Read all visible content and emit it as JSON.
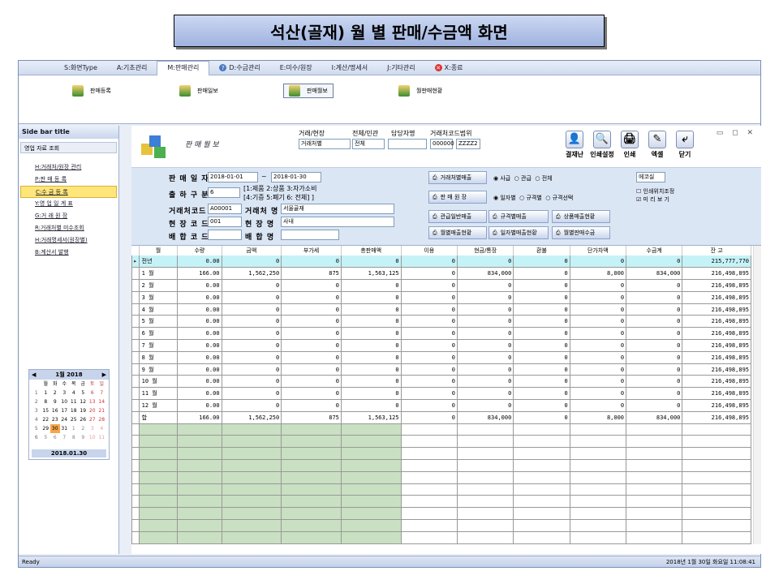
{
  "banner": "석산(골재) 월 별 판매/수금액  화면",
  "menu": [
    {
      "label": "S:화면Type"
    },
    {
      "label": "A:기초관리"
    },
    {
      "label": "M:판매관리",
      "active": true
    },
    {
      "label": "D:수금관리",
      "icon": "?"
    },
    {
      "label": "E:미수/원장"
    },
    {
      "label": "I:계산/명세서"
    },
    {
      "label": "J:기타관리"
    },
    {
      "label": "X:종료",
      "icon": "x"
    }
  ],
  "ribbon": [
    "판매등록",
    "판매일보",
    "판매월보",
    "월판매현황"
  ],
  "sidebar": {
    "title": "Side bar title",
    "group": "영업 자료 조회",
    "items": [
      "H:거래처/원장 관리",
      "P:판 매 등 록",
      "C:수 금 등 록",
      "Y:영 업 일 계 표",
      "G:거 래 원 장",
      "R:거래처별 미수조회",
      "H:거래명세서(원장별)",
      "B:계산서 발행"
    ],
    "selected": 2
  },
  "calendar": {
    "month": "1월 2018",
    "days": [
      "월",
      "화",
      "수",
      "목",
      "금",
      "토",
      "일"
    ],
    "weeks": [
      [
        "1",
        "2",
        "3",
        "4",
        "5",
        "6",
        "7"
      ],
      [
        "8",
        "9",
        "10",
        "11",
        "12",
        "13",
        "14"
      ],
      [
        "15",
        "16",
        "17",
        "18",
        "19",
        "20",
        "21"
      ],
      [
        "22",
        "23",
        "24",
        "25",
        "26",
        "27",
        "28"
      ],
      [
        "29",
        "30",
        "31",
        "1",
        "2",
        "3",
        "4"
      ],
      [
        "5",
        "6",
        "7",
        "8",
        "9",
        "10",
        "11"
      ]
    ],
    "week_nums": [
      "1",
      "2",
      "3",
      "4",
      "5",
      "6"
    ],
    "today": "2018.01.30"
  },
  "main": {
    "title": "판 매 월 보",
    "trade_label": "거래/현장",
    "trade_value": "거래처별",
    "type_label": "전체/민관",
    "type_value": "전체",
    "staff_label": "담당자명",
    "range_label": "거래처코드범위",
    "range_from": "000000",
    "range_to": "ZZZZ2",
    "tools": [
      "결재난",
      "인쇄설정",
      "인쇄",
      "엑셀",
      "닫기"
    ],
    "date_label": "판 매 일 자",
    "date_from": "2018-01-01",
    "date_to": "2018-01-30",
    "out_label": "출 하 구 분",
    "out_value": "6",
    "out_hint1": "[1:제품 2:상품 3:자가소비",
    "out_hint2": "[4:기증 5:폐기 6: 전체] ]",
    "client_code_label": "거래처코드",
    "client_code": "A00001",
    "client_name_label": "거래처 명",
    "client_name": "서울골재",
    "site_code_label": "현 장 코 드",
    "site_code": "001",
    "site_name_label": "현 장 명",
    "site_name": "사내",
    "mix_code_label": "배 합 코 드",
    "mix_name_label": "배 합 명",
    "buttons": [
      "거래처별매출",
      "판 매 원 장",
      "관급일반매출",
      "규격별매출",
      "상품매출현황",
      "월별매출현황",
      "일자별매출현황",
      "월별판매수금"
    ],
    "radios1": [
      "사급",
      "관급",
      "전체"
    ],
    "radios2": [
      "일자별",
      "규격별",
      "규격선택"
    ],
    "combo": "에코실",
    "check1": "인쇄위치조정",
    "check2": "미 리 보 기"
  },
  "table": {
    "headers": [
      "월",
      "수량",
      "금액",
      "부가세",
      "총판매액",
      "이용",
      "현금/통장",
      "환불",
      "단가차액",
      "수금계",
      "잔  고"
    ],
    "rows": [
      [
        "전년",
        "0.00",
        "0",
        "0",
        "0",
        "0",
        "0",
        "0",
        "0",
        "0",
        "215,777,770"
      ],
      [
        "1 월",
        "166.00",
        "1,562,250",
        "875",
        "1,563,125",
        "0",
        "834,000",
        "0",
        "8,000",
        "834,000",
        "216,498,895"
      ],
      [
        "2 월",
        "0.00",
        "0",
        "0",
        "0",
        "0",
        "0",
        "0",
        "0",
        "0",
        "216,498,895"
      ],
      [
        "3 월",
        "0.00",
        "0",
        "0",
        "0",
        "0",
        "0",
        "0",
        "0",
        "0",
        "216,498,895"
      ],
      [
        "4 월",
        "0.00",
        "0",
        "0",
        "0",
        "0",
        "0",
        "0",
        "0",
        "0",
        "216,498,895"
      ],
      [
        "5 월",
        "0.00",
        "0",
        "0",
        "0",
        "0",
        "0",
        "0",
        "0",
        "0",
        "216,498,895"
      ],
      [
        "6 월",
        "0.00",
        "0",
        "0",
        "0",
        "0",
        "0",
        "0",
        "0",
        "0",
        "216,498,895"
      ],
      [
        "7 월",
        "0.00",
        "0",
        "0",
        "0",
        "0",
        "0",
        "0",
        "0",
        "0",
        "216,498,895"
      ],
      [
        "8 월",
        "0.00",
        "0",
        "0",
        "0",
        "0",
        "0",
        "0",
        "0",
        "0",
        "216,498,895"
      ],
      [
        "9 월",
        "0.00",
        "0",
        "0",
        "0",
        "0",
        "0",
        "0",
        "0",
        "0",
        "216,498,895"
      ],
      [
        "10 월",
        "0.00",
        "0",
        "0",
        "0",
        "0",
        "0",
        "0",
        "0",
        "0",
        "216,498,895"
      ],
      [
        "11 월",
        "0.00",
        "0",
        "0",
        "0",
        "0",
        "0",
        "0",
        "0",
        "0",
        "216,498,895"
      ],
      [
        "12 월",
        "0.00",
        "0",
        "0",
        "0",
        "0",
        "0",
        "0",
        "0",
        "0",
        "216,498,895"
      ],
      [
        "합",
        "166.00",
        "1,562,250",
        "875",
        "1,563,125",
        "0",
        "834,000",
        "0",
        "8,000",
        "834,000",
        "216,498,895"
      ]
    ],
    "empty_rows": 10
  },
  "status": {
    "left": "Ready",
    "right": "2018년 1월 30일 화요일 11:08:41"
  }
}
